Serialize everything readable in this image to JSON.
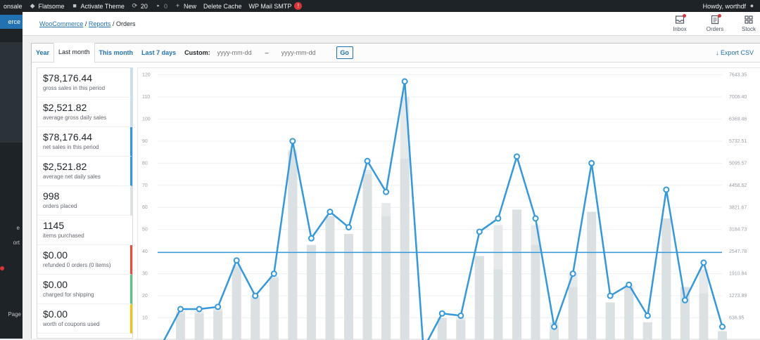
{
  "adminbar": {
    "items": [
      {
        "label": "onsale",
        "icon": "site-icon"
      },
      {
        "label": "Flatsome",
        "icon": "flatsome-icon"
      },
      {
        "label": "Activate Theme",
        "icon": "lock-icon"
      },
      {
        "label": "20",
        "icon": "updates-icon"
      },
      {
        "label": "0",
        "icon": "comment-icon"
      },
      {
        "label": "New",
        "icon": "plus-icon"
      },
      {
        "label": "Delete Cache",
        "icon": ""
      },
      {
        "label": "WP Mail SMTP",
        "icon": ""
      }
    ],
    "smtp_badge": "!",
    "howdy": "Howdy, worthdf"
  },
  "sidebar": {
    "active_label": "erce",
    "fragments": [
      "e",
      "ort",
      "Page"
    ]
  },
  "header": {
    "breadcrumb": {
      "woocommerce": "WooCommerce",
      "sep": "/",
      "reports": "Reports",
      "current": "Orders"
    },
    "buttons": [
      {
        "label": "Inbox",
        "icon": "inbox-icon"
      },
      {
        "label": "Orders",
        "icon": "orders-icon"
      },
      {
        "label": "Stock",
        "icon": "stock-icon"
      }
    ]
  },
  "range": {
    "tabs": [
      "Year",
      "Last month",
      "This month",
      "Last 7 days"
    ],
    "active_tab": 1,
    "custom_label": "Custom:",
    "from_placeholder": "yyyy-mm-dd",
    "dash": "–",
    "to_placeholder": "yyyy-mm-dd",
    "go": "Go",
    "export": "Export CSV"
  },
  "legend": [
    {
      "amount": "$78,176.44",
      "label": "gross sales in this period",
      "color": "#c5dff0"
    },
    {
      "amount": "$2,521.82",
      "label": "average gross daily sales",
      "color": "#c5dff0"
    },
    {
      "amount": "$78,176.44",
      "label": "net sales in this period",
      "color": "#3498db"
    },
    {
      "amount": "$2,521.82",
      "label": "average net daily sales",
      "color": "#3498db"
    },
    {
      "amount": "998",
      "label": "orders placed",
      "color": "#dbe1e3"
    },
    {
      "amount": "1145",
      "label": "items purchased",
      "color": "#ffffff"
    },
    {
      "amount": "$0.00",
      "label": "refunded 0 orders (0 items)",
      "color": "#e74c3c"
    },
    {
      "amount": "$0.00",
      "label": "charged for shipping",
      "color": "#5cc488"
    },
    {
      "amount": "$0.00",
      "label": "worth of coupons used",
      "color": "#f1c40f"
    }
  ],
  "chart_data": {
    "type": "bar",
    "left_axis": {
      "ticks": [
        "10",
        "20",
        "30",
        "40",
        "50",
        "60",
        "70",
        "80",
        "90",
        "100",
        "110",
        "120"
      ],
      "range": [
        0,
        123
      ]
    },
    "right_axis": {
      "ticks": [
        "636.95",
        "1273.89",
        "1910.84",
        "2547.78",
        "3184.73",
        "3821.67",
        "4458.62",
        "5095.57",
        "5732.51",
        "6369.46",
        "7006.40",
        "7643.35"
      ],
      "range": [
        0,
        7836.2
      ]
    },
    "series": [
      {
        "kind": "bar-total",
        "color": "#e6e9ea",
        "values": [
          0,
          13,
          13,
          14,
          34,
          20,
          29,
          86,
          43,
          56,
          48,
          77,
          62,
          110,
          0,
          10,
          10,
          38,
          52,
          59,
          52,
          8,
          30,
          58,
          17,
          25,
          8,
          55,
          24,
          32,
          4
        ]
      },
      {
        "kind": "bar-main",
        "color": "#dbe1e3",
        "values": [
          0,
          12,
          12,
          13,
          33,
          19,
          28,
          85,
          43,
          56,
          48,
          75,
          56,
          82,
          0,
          10,
          9,
          38,
          32,
          59,
          43,
          5,
          24,
          58,
          17,
          24,
          8,
          55,
          24,
          21,
          4
        ]
      },
      {
        "kind": "line",
        "color": "#3498db",
        "values": [
          -2,
          14,
          14,
          15,
          36,
          20,
          30,
          90,
          46,
          58,
          51,
          81,
          67,
          117,
          -4,
          12,
          11,
          49,
          55,
          83,
          55,
          6,
          30,
          80,
          20,
          25,
          11,
          68,
          18,
          35,
          6
        ]
      },
      {
        "kind": "average-line",
        "color": "#3498db",
        "value": 39.6
      }
    ]
  }
}
